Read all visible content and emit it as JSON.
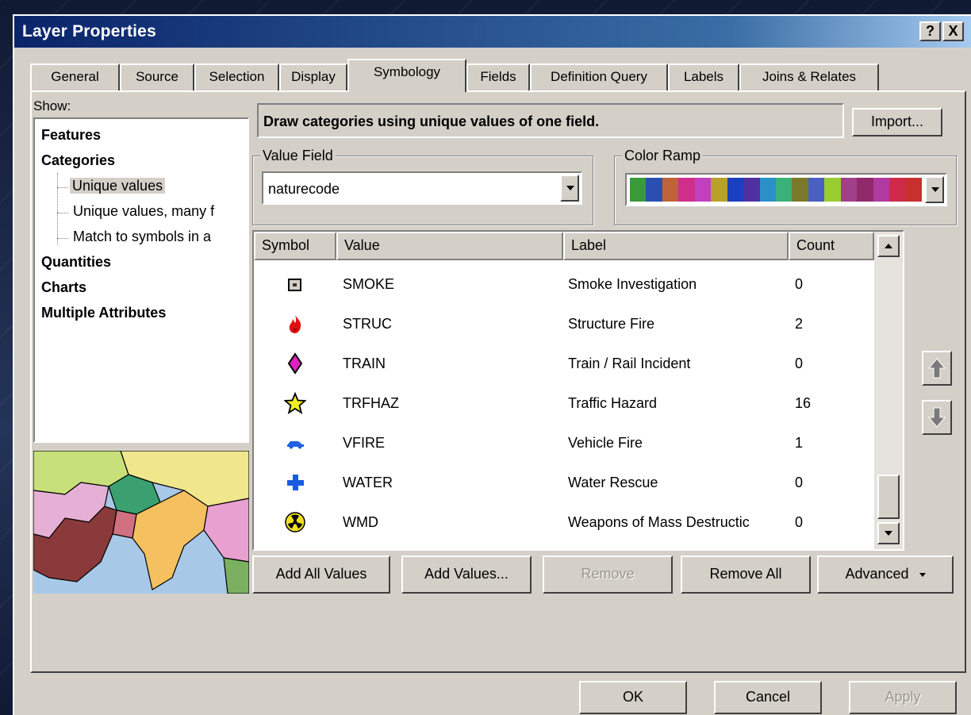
{
  "window": {
    "title": "Layer Properties",
    "help_label": "?",
    "close_label": "X"
  },
  "tabs": [
    {
      "label": "General"
    },
    {
      "label": "Source"
    },
    {
      "label": "Selection"
    },
    {
      "label": "Display"
    },
    {
      "label": "Symbology"
    },
    {
      "label": "Fields"
    },
    {
      "label": "Definition Query"
    },
    {
      "label": "Labels"
    },
    {
      "label": "Joins & Relates"
    }
  ],
  "active_tab": "Symbology",
  "show": {
    "label": "Show:",
    "items": {
      "features": "Features",
      "categories": "Categories",
      "unique_values": "Unique values",
      "unique_values_many": "Unique values, many f",
      "match_symbols": "Match to symbols in a",
      "quantities": "Quantities",
      "charts": "Charts",
      "multiple_attributes": "Multiple Attributes"
    },
    "selected": "Unique values"
  },
  "description": "Draw categories using unique values of one field.",
  "import_label": "Import...",
  "value_field": {
    "label": "Value Field",
    "value": "naturecode"
  },
  "color_ramp": {
    "label": "Color Ramp",
    "colors": [
      "#3a9a3a",
      "#2a4fb0",
      "#c0623a",
      "#cf2f8a",
      "#c040c0",
      "#b8a02a",
      "#1a3fc0",
      "#5030a0",
      "#2a90c8",
      "#3ab07a",
      "#7a7a2a",
      "#4a60c0",
      "#9acd32",
      "#a0408a",
      "#902a6a",
      "#b03aa0",
      "#d02a4a",
      "#c83030"
    ]
  },
  "table": {
    "columns": {
      "symbol": "Symbol",
      "value": "Value",
      "label": "Label",
      "count": "Count"
    },
    "rows": [
      {
        "icon": "smoke-icon",
        "value": "SMOKE",
        "label": "Smoke Investigation",
        "count": "0"
      },
      {
        "icon": "fire-icon",
        "value": "STRUC",
        "label": "Structure Fire",
        "count": "2"
      },
      {
        "icon": "diamond-icon",
        "value": "TRAIN",
        "label": "Train / Rail Incident",
        "count": "0"
      },
      {
        "icon": "star-icon",
        "value": "TRFHAZ",
        "label": "Traffic Hazard",
        "count": "16"
      },
      {
        "icon": "car-icon",
        "value": "VFIRE",
        "label": "Vehicle Fire",
        "count": "1"
      },
      {
        "icon": "cross-icon",
        "value": "WATER",
        "label": "Water Rescue",
        "count": "0"
      },
      {
        "icon": "radiation-icon",
        "value": "WMD",
        "label": "Weapons of Mass Destructic",
        "count": "0"
      }
    ]
  },
  "buttons": {
    "add_all": "Add All Values",
    "add_values": "Add Values...",
    "remove": "Remove",
    "remove_all": "Remove All",
    "advanced": "Advanced",
    "ok": "OK",
    "cancel": "Cancel",
    "apply": "Apply"
  }
}
